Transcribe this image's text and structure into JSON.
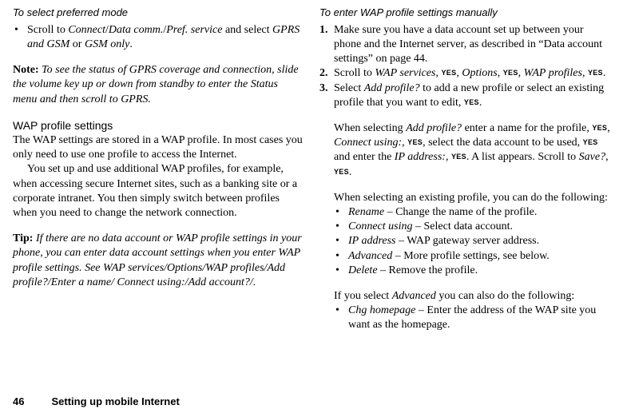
{
  "left": {
    "subhead": "To select preferred mode",
    "bullet1_a": "Scroll to ",
    "bullet1_b": "Connect",
    "bullet1_c": "/",
    "bullet1_d": "Data comm.",
    "bullet1_e": "/",
    "bullet1_f": "Pref. service",
    "bullet1_g": " and select ",
    "bullet1_h": "GPRS and GSM",
    "bullet1_i": " or ",
    "bullet1_j": "GSM only",
    "bullet1_k": ".",
    "note_label": "Note:",
    "note_body": " To see the status of GPRS coverage and connection, slide the volume key up or down from standby to enter the Status menu and then scroll to GPRS.",
    "h_wap": "WAP profile settings",
    "wap_p1": "The WAP settings are stored in a WAP profile. In most cases you only need to use one profile to access the Internet.",
    "wap_p2": "You set up and use additional WAP profiles, for example, when accessing secure Internet sites, such as a banking site or a corporate intranet. You then simply switch between profiles when you need to change the network connection.",
    "tip_label": "Tip:",
    "tip_body": " If there are no data account or WAP profile settings in your phone, you can enter data account settings when you enter WAP profile settings. See WAP services/Options/WAP profiles/Add profile?/Enter a name/ Connect using:/Add account?/."
  },
  "right": {
    "subhead": "To enter WAP profile settings manually",
    "s1_a": "Make sure you have a data account set up between your phone and the Internet server, as described in “Data account settings” on page 44.",
    "s2_a": "Scroll to ",
    "s2_b": "WAP services",
    "s2_c": ", ",
    "yes": "YES",
    "s2_d": ", ",
    "s2_e": "Options",
    "s2_f": ", ",
    "s2_g": ", ",
    "s2_h": "WAP profiles",
    "s2_i": ", ",
    "s2_j": ".",
    "s3_a": "Select ",
    "s3_b": "Add profile?",
    "s3_c": " to add a new profile or select an existing profile that you want to edit, ",
    "s3_d": ".",
    "p_add_a": "When selecting ",
    "p_add_b": "Add profile?",
    "p_add_c": " enter a name for the profile, ",
    "p_add_d": ", ",
    "p_add_e": "Connect using:",
    "p_add_f": ", ",
    "p_add_g": ", select the data account to be used, ",
    "p_add_h": " and enter the ",
    "p_add_i": "IP address:",
    "p_add_j": ", ",
    "p_add_k": ". A list appears. Scroll to ",
    "p_add_l": "Save?",
    "p_add_m": ", ",
    "p_add_n": ".",
    "p_exist": "When selecting an existing profile, you can do the following:",
    "bl1_a": " Rename",
    "bl1_b": " – Change the name of the profile.",
    "bl2_a": "Connect using",
    "bl2_b": " – Select data account.",
    "bl3_a": "IP address",
    "bl3_b": " – WAP gateway server address.",
    "bl4_a": "Advanced",
    "bl4_b": " – More profile settings, see below.",
    "bl5_a": "Delete",
    "bl5_b": " – Remove the profile.",
    "adv_intro_a": "If you select ",
    "adv_intro_b": "Advanced",
    "adv_intro_c": " you can also do the following:",
    "adv1_a": "Chg homepage",
    "adv1_b": " – Enter the address of the WAP site you want as the homepage."
  },
  "footer": {
    "page": "46",
    "title": "Setting up mobile Internet"
  }
}
